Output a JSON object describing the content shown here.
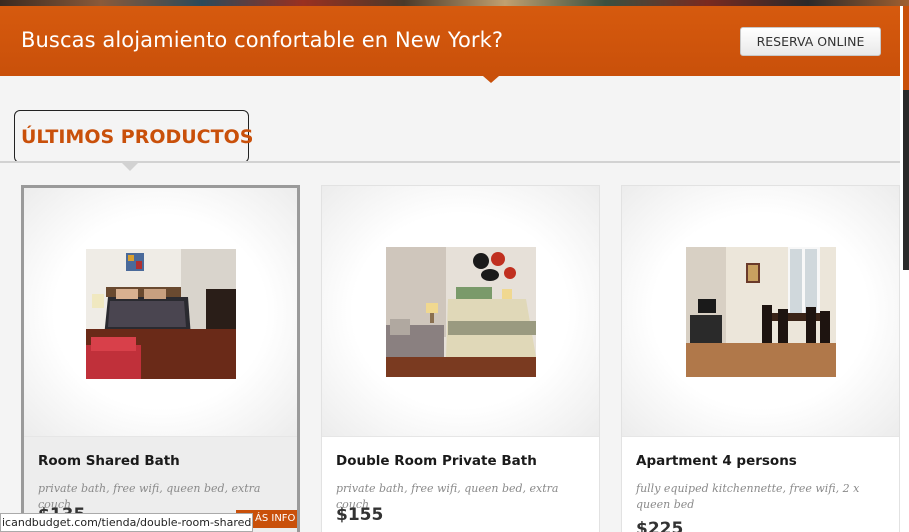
{
  "banner": {
    "title": "Buscas alojamiento confortable en New York?",
    "reserve_label": "RESERVA ONLINE"
  },
  "section": {
    "title": "ÚLTIMOS PRODUCTOS"
  },
  "products": [
    {
      "name": "Room Shared Bath",
      "description": "private bath, free wifi,  queen bed, extra couch",
      "price": "$135"
    },
    {
      "name": "Double Room Private Bath",
      "description": "private bath, free wifi,  queen bed, extra couch",
      "price": "$155"
    },
    {
      "name": "Apartment 4 persons",
      "description": "fully equiped kitchennette, free wifi, 2 x queen bed",
      "price": "$225"
    }
  ],
  "more_info_label": "ÁS INFO",
  "status_url": "icandbudget.com/tienda/double-room-shared-bath/",
  "colors": {
    "accent": "#c9500a",
    "background": "#f4f4f4"
  }
}
